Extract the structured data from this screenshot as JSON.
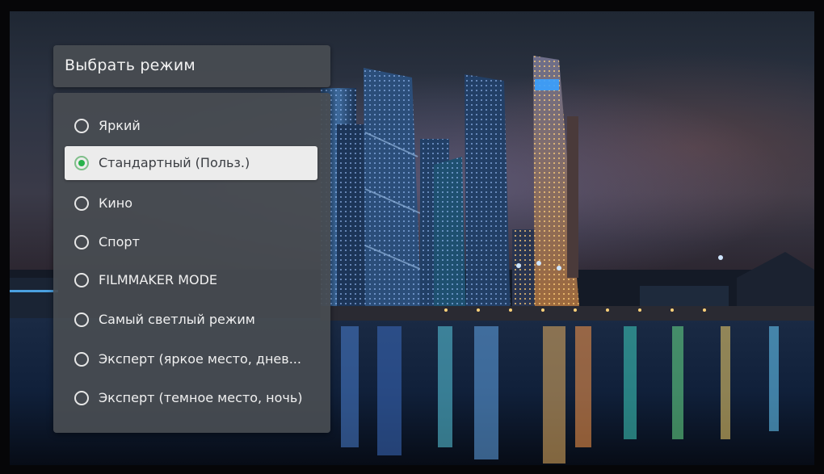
{
  "menu": {
    "title": "Выбрать режим",
    "selected_index": 1,
    "options": [
      {
        "label": "Яркий"
      },
      {
        "label": "Стандартный (Польз.)"
      },
      {
        "label": "Кино"
      },
      {
        "label": "Спорт"
      },
      {
        "label": "FILMMAKER MODE"
      },
      {
        "label": "Самый светлый режим"
      },
      {
        "label": "Эксперт (яркое место, днев..."
      },
      {
        "label": "Эксперт (темное место, ночь)"
      }
    ]
  },
  "colors": {
    "panel": "#484c52",
    "selected_bg": "#ececec",
    "radio_active": "#27b24a"
  },
  "icons": {
    "radio_off": "radio-unchecked-icon",
    "radio_on": "radio-checked-icon"
  }
}
